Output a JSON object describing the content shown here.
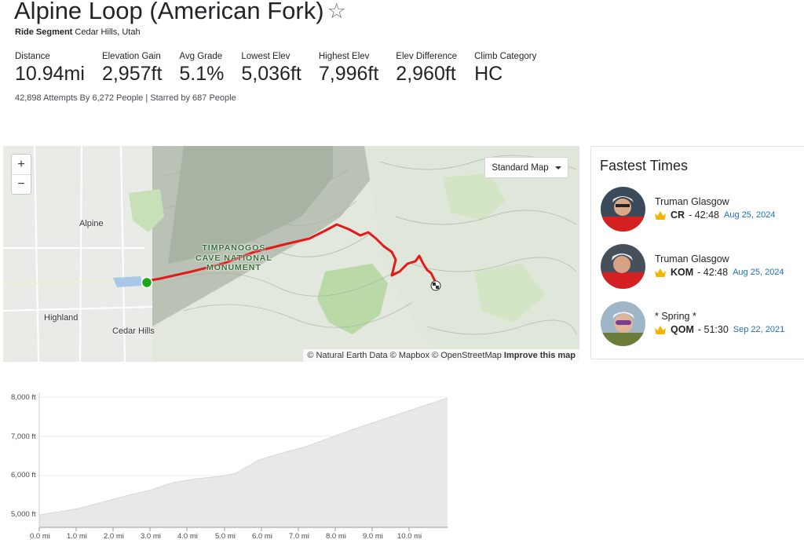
{
  "segment": {
    "title": "Alpine Loop (American Fork)",
    "type": "Ride Segment",
    "location": "Cedar Hills, Utah",
    "starred": false
  },
  "stats": [
    {
      "label": "Distance",
      "value": "10.94mi"
    },
    {
      "label": "Elevation Gain",
      "value": "2,957ft"
    },
    {
      "label": "Avg Grade",
      "value": "5.1%"
    },
    {
      "label": "Lowest Elev",
      "value": "5,036ft"
    },
    {
      "label": "Highest Elev",
      "value": "7,996ft"
    },
    {
      "label": "Elev Difference",
      "value": "2,960ft"
    },
    {
      "label": "Climb Category",
      "value": "HC"
    }
  ],
  "attempts": "42,898 Attempts By 6,272 People | Starred by 687 People",
  "map": {
    "zoom_in": "+",
    "zoom_out": "−",
    "map_type": "Standard Map",
    "labels": {
      "alpine": "Alpine",
      "highland": "Highland",
      "cedar_hills": "Cedar Hills",
      "park_line1": "TIMPANOGOS",
      "park_line2": "CAVE NATIONAL",
      "park_line3": "MONUMENT"
    },
    "attribution": {
      "natural_earth": "© Natural Earth Data",
      "mapbox": "© Mapbox",
      "osm": "© OpenStreetMap",
      "improve": "Improve this map"
    },
    "route_color": "#e21a1a",
    "start_color": "#1aa81a"
  },
  "fastest_times": {
    "title": "Fastest Times",
    "entries": [
      {
        "name": "Truman Glasgow",
        "rank": "CR",
        "time": "- 42:48",
        "date": "Aug 25, 2024"
      },
      {
        "name": "Truman Glasgow",
        "rank": "KOM",
        "time": "- 42:48",
        "date": "Aug 25, 2024"
      },
      {
        "name": "* Spring *",
        "rank": "QOM",
        "time": "- 51:30",
        "date": "Sep 22, 2021"
      }
    ],
    "crown_color": "#f5b400",
    "date_color": "#1f6fb5"
  },
  "elevation_profile": {
    "y_ticks": [
      "8,000 ft",
      "7,000 ft",
      "6,000 ft",
      "5,000 ft"
    ],
    "x_ticks": [
      "0.0 mi",
      "1.0 mi",
      "2.0 mi",
      "3.0 mi",
      "4.0 mi",
      "5.0 mi",
      "6.0 mi",
      "7.0 mi",
      "8.0 mi",
      "9.0 mi",
      "10.0 mi"
    ],
    "fill_color": "#e8e8e8"
  }
}
